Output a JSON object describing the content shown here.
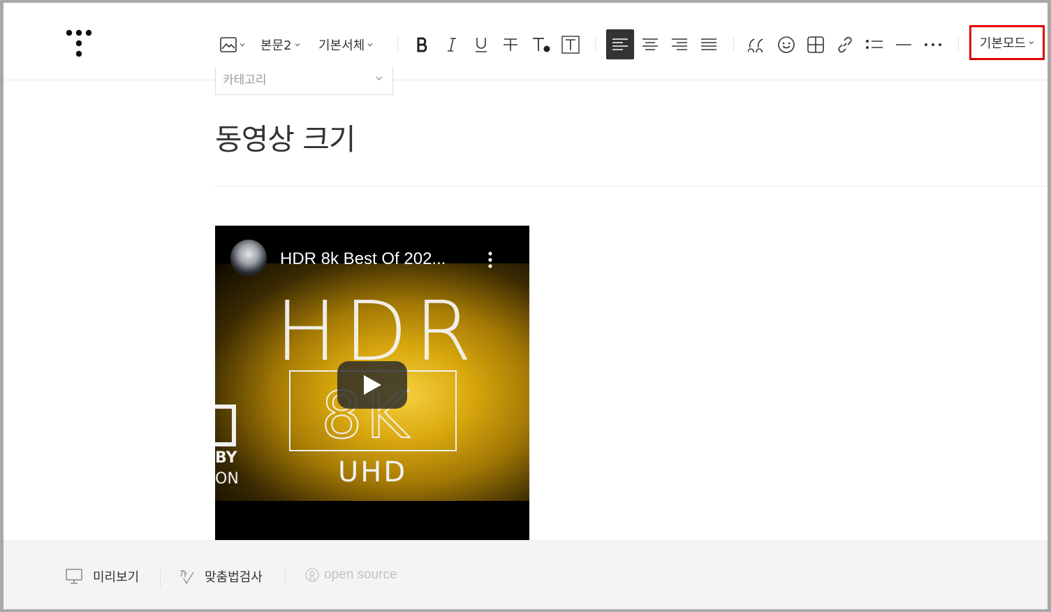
{
  "toolbar": {
    "font_size_label": "본문2",
    "font_family_label": "기본서체",
    "mode_label": "기본모드",
    "accent_highlight": "#e00000"
  },
  "category": {
    "placeholder": "카테고리"
  },
  "post": {
    "title": "동영상 크기"
  },
  "video": {
    "title": "HDR 8k Best Of 202...",
    "art_text_hdr": "HDR",
    "art_text_8k": "8K",
    "art_text_uhd": "UHD",
    "side_text_1": "BY",
    "side_text_2": "ON"
  },
  "footer": {
    "preview_label": "미리보기",
    "spellcheck_label": "맞춤법검사",
    "open_source_label": "open source"
  },
  "icons": [
    "logo-icon",
    "image-icon",
    "bold-icon",
    "italic-icon",
    "underline-icon",
    "strikethrough-icon",
    "text-color-icon",
    "text-bg-icon",
    "align-left-icon",
    "align-center-icon",
    "align-right-icon",
    "align-justify-icon",
    "quote-icon",
    "emoticon-icon",
    "table-icon",
    "link-icon",
    "list-icon",
    "horizontal-rule-icon",
    "more-icon",
    "monitor-icon",
    "spellcheck-icon",
    "open-source-icon",
    "play-icon"
  ]
}
